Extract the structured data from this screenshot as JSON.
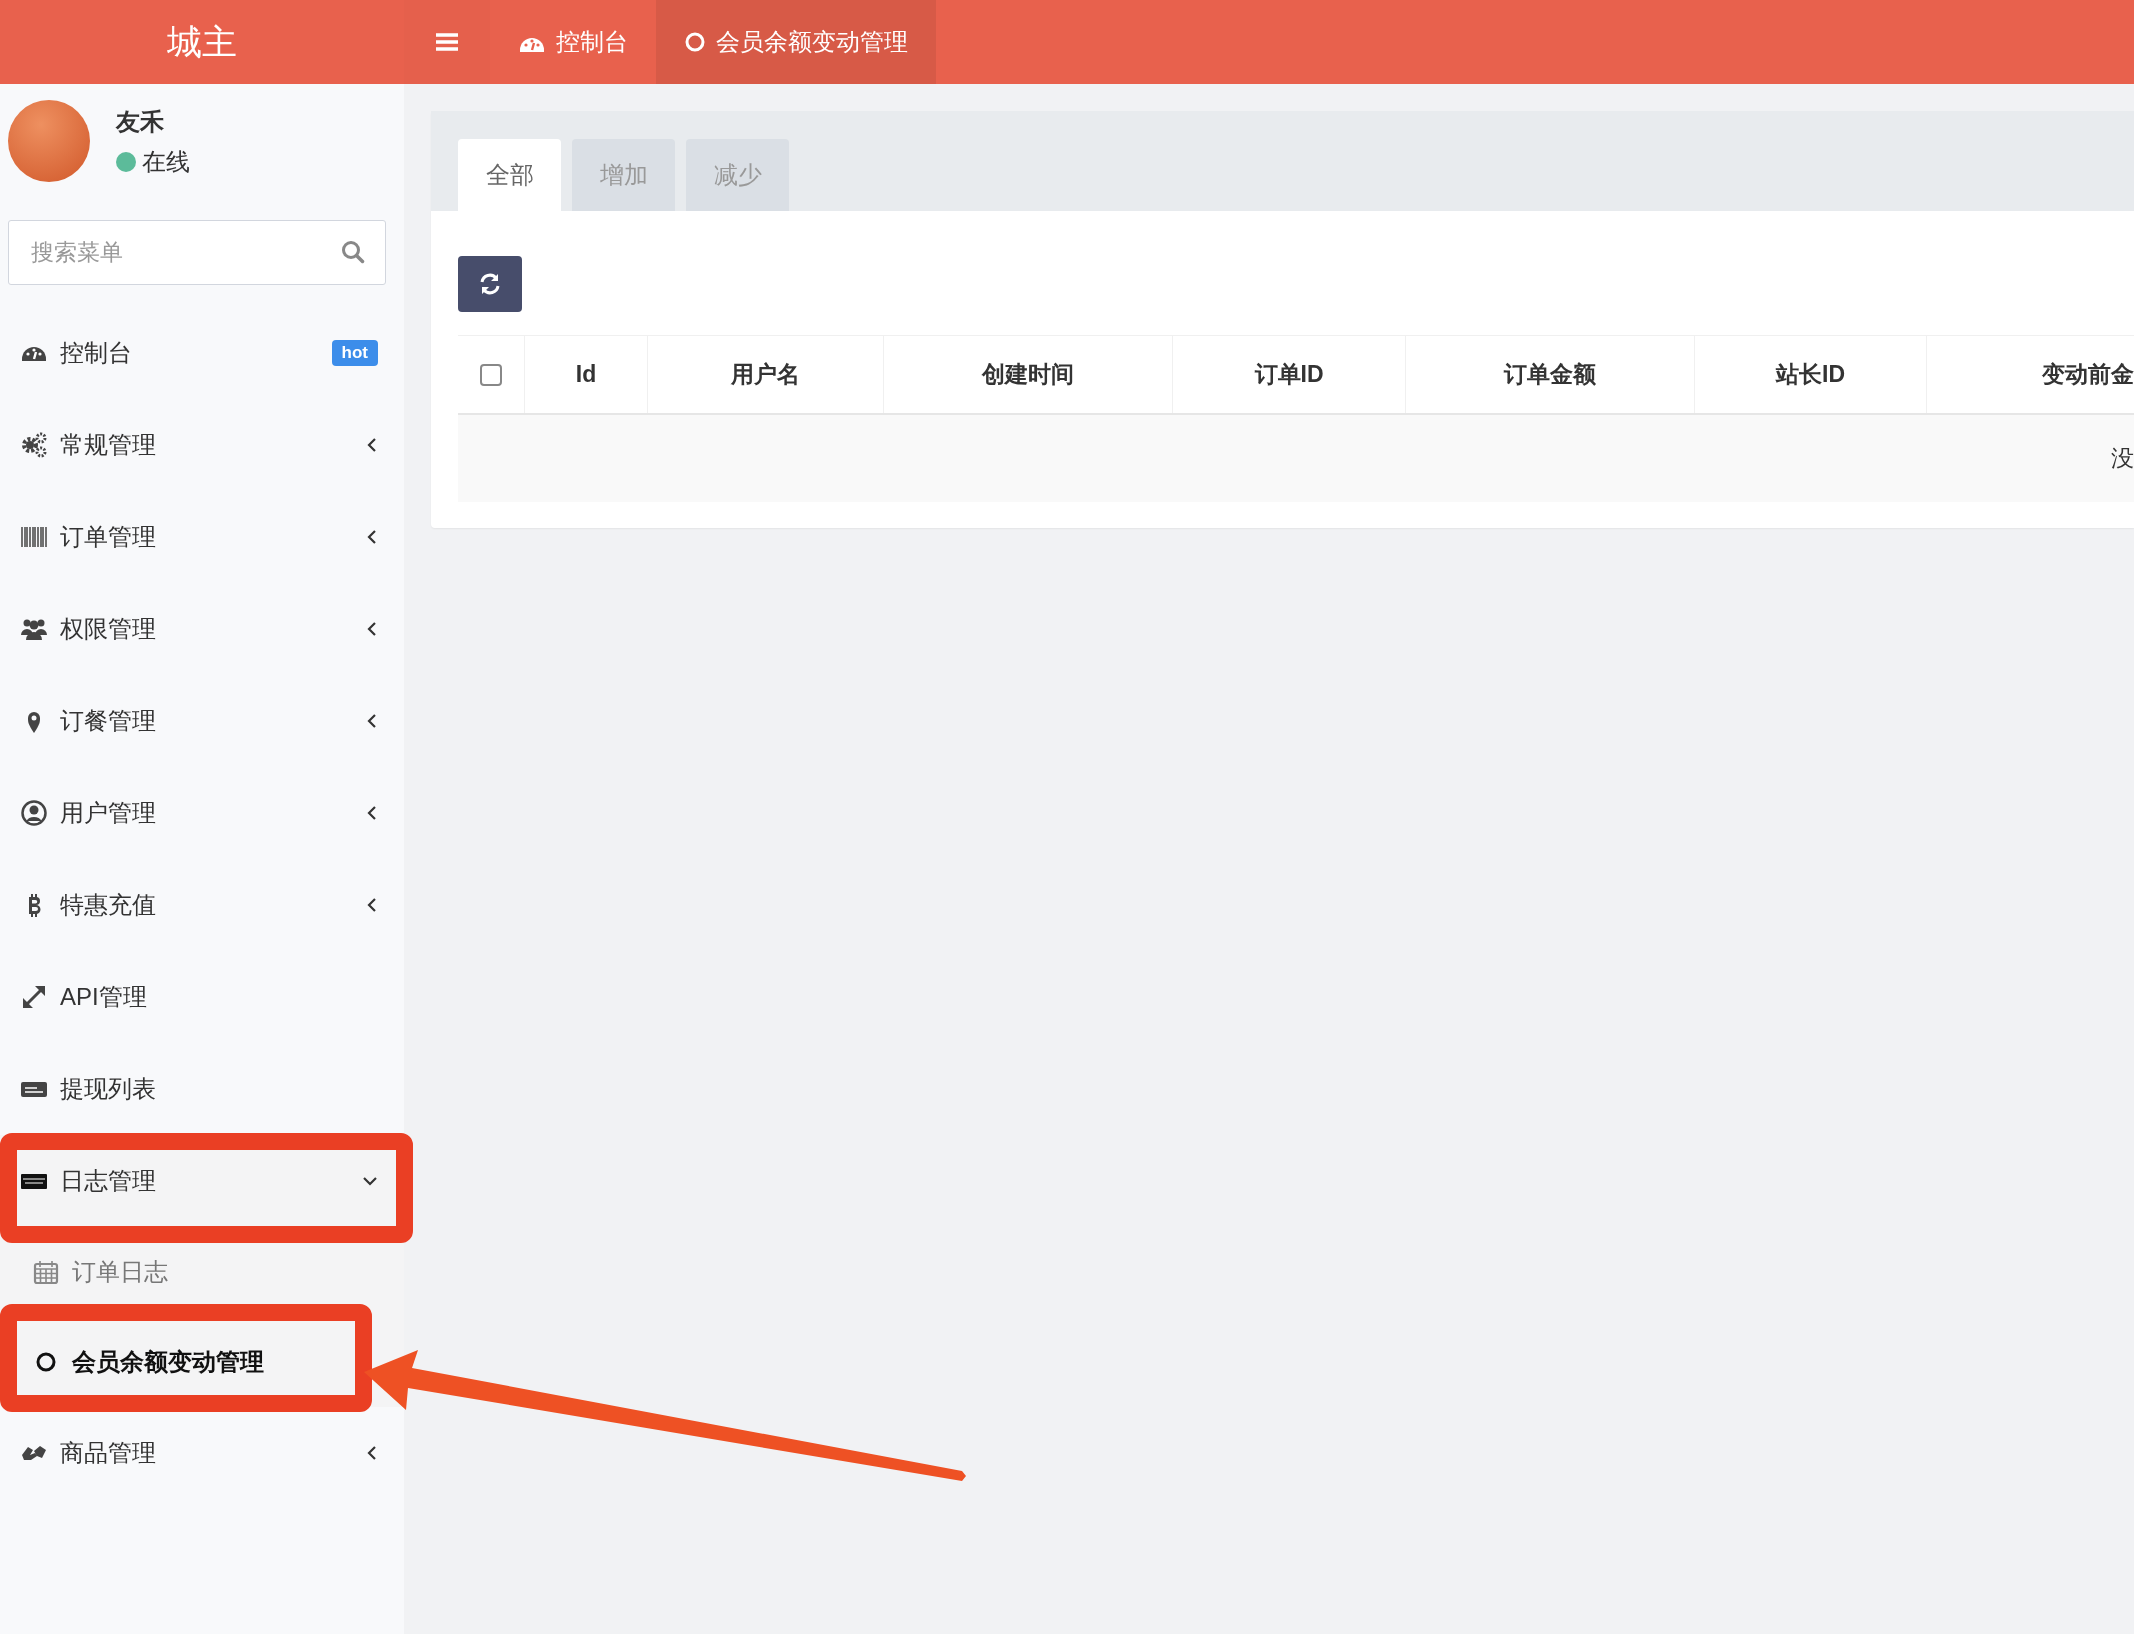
{
  "header": {
    "logo": "城主",
    "nav_tabs": [
      {
        "label": "控制台",
        "selected": false
      },
      {
        "label": "会员余额变动管理",
        "selected": true
      }
    ]
  },
  "sidebar": {
    "user": {
      "name": "友禾",
      "status": "在线"
    },
    "search": {
      "placeholder": "搜索菜单"
    },
    "items": [
      {
        "label": "控制台",
        "badge": "hot",
        "highlighted": false
      },
      {
        "label": "常规管理",
        "expanded": false,
        "highlighted": false
      },
      {
        "label": "订单管理",
        "expanded": false,
        "highlighted": false
      },
      {
        "label": "权限管理",
        "expanded": false,
        "highlighted": false
      },
      {
        "label": "订餐管理",
        "expanded": false,
        "highlighted": false
      },
      {
        "label": "用户管理",
        "expanded": false,
        "highlighted": false
      },
      {
        "label": "特惠充值",
        "expanded": false,
        "highlighted": false
      },
      {
        "label": "API管理",
        "highlighted": false
      },
      {
        "label": "提现列表",
        "highlighted": false
      },
      {
        "label": "日志管理",
        "expanded": true,
        "highlighted": true,
        "children": [
          {
            "label": "订单日志",
            "selected": false,
            "highlighted": false,
            "pointed": false
          },
          {
            "label": "会员余额变动管理",
            "selected": true,
            "highlighted": true,
            "pointed": true
          }
        ]
      },
      {
        "label": "商品管理",
        "expanded": false,
        "highlighted": false
      }
    ]
  },
  "main": {
    "tabs": [
      {
        "label": "全部",
        "selected": true
      },
      {
        "label": "增加",
        "selected": false
      },
      {
        "label": "减少",
        "selected": false
      }
    ],
    "table": {
      "select_all": {
        "checked": false
      },
      "columns": [
        "Id",
        "用户名",
        "创建时间",
        "订单ID",
        "订单金额",
        "站长ID",
        "变动前金"
      ],
      "empty_text": "没"
    }
  }
}
